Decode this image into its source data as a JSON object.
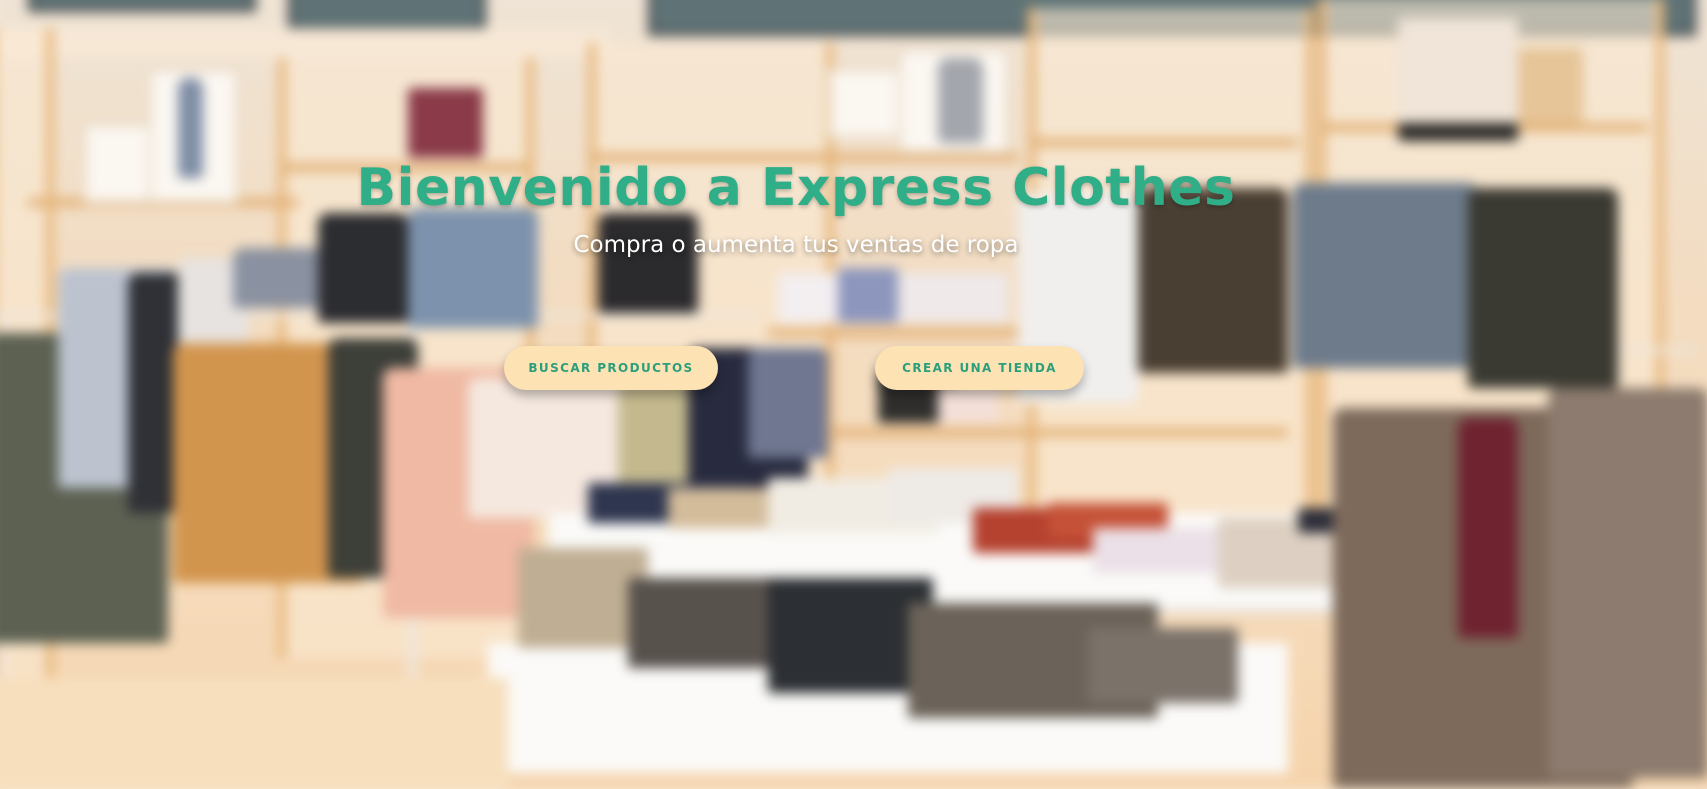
{
  "hero": {
    "title": "Bienvenido a Express Clothes",
    "subtitle": "Compra o aumenta tus ventas de ropa",
    "buttons": {
      "search_products": "BUSCAR PRODUCTOS",
      "create_store": "CREAR UNA TIENDA"
    },
    "background": "blurred-clothing-store-photo"
  },
  "colors": {
    "title": "#2fae87",
    "button_bg": "#fde2b3",
    "button_text": "#2b9f7c",
    "subtitle": "#ffffff"
  }
}
